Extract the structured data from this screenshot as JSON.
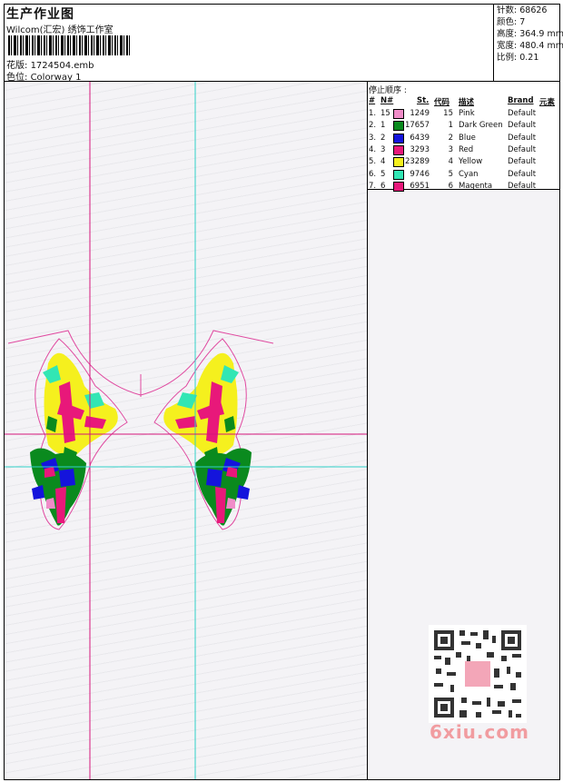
{
  "header": {
    "title": "生产作业图",
    "studio": "Wilcom(汇宏) 绣饰工作室",
    "design_label": "花版:",
    "design_file": "1724504.emb",
    "colorway_label": "色位:",
    "colorway": "Colorway 1"
  },
  "specs": [
    {
      "label": "针数:",
      "value": "68626"
    },
    {
      "label": "颜色:",
      "value": "7"
    },
    {
      "label": "高度:",
      "value": "364.9 mm"
    },
    {
      "label": "宽度:",
      "value": "480.4 mm"
    },
    {
      "label": "比例:",
      "value": "0.21"
    }
  ],
  "stop_sequence": {
    "title": "停止顺序 :",
    "headers": {
      "num": "#",
      "needle": "N#",
      "stitches": "St.",
      "code": "代码",
      "desc": "描述",
      "brand": "Brand",
      "element": "元素"
    },
    "rows": [
      {
        "num": "1.",
        "needle": "15",
        "color": "#f08cc8",
        "stitches": "1249",
        "code": "15",
        "desc": "Pink",
        "brand": "Default"
      },
      {
        "num": "2.",
        "needle": "1",
        "color": "#0a8a1e",
        "stitches": "17657",
        "code": "1",
        "desc": "Dark Green",
        "brand": "Default"
      },
      {
        "num": "3.",
        "needle": "2",
        "color": "#1414dc",
        "stitches": "6439",
        "code": "2",
        "desc": "Blue",
        "brand": "Default"
      },
      {
        "num": "4.",
        "needle": "3",
        "color": "#e8187a",
        "stitches": "3293",
        "code": "3",
        "desc": "Red",
        "brand": "Default"
      },
      {
        "num": "5.",
        "needle": "4",
        "color": "#f5f01e",
        "stitches": "23289",
        "code": "4",
        "desc": "Yellow",
        "brand": "Default"
      },
      {
        "num": "6.",
        "needle": "5",
        "color": "#32e6b4",
        "stitches": "9746",
        "code": "5",
        "desc": "Cyan",
        "brand": "Default"
      },
      {
        "num": "7.",
        "needle": "6",
        "color": "#e8187a",
        "stitches": "6951",
        "code": "6",
        "desc": "Magenta",
        "brand": "Default"
      }
    ]
  },
  "watermark": "6xiu.com",
  "colors": {
    "magenta_guide": "#d4157a",
    "cyan_guide": "#30d0c8",
    "outline": "#e04aa0"
  }
}
